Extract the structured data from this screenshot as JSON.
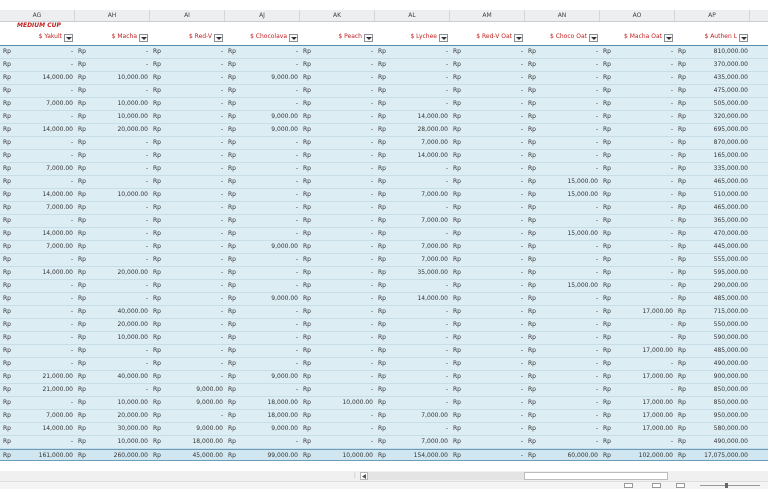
{
  "columns": [
    "AG",
    "AH",
    "AI",
    "AJ",
    "AK",
    "AL",
    "AM",
    "AN",
    "AO",
    "AP"
  ],
  "section_label": "MEDIUM CUP",
  "fields": [
    "$ Yakult",
    "$ Macha",
    "$ Red-V",
    "$ Chocolava",
    "$ Peach",
    "$ Lychee",
    "$ Red-V Oat",
    "$ Choco Oat",
    "$ Macha Oat",
    "$ Authen L"
  ],
  "currency": "Rp",
  "rows": [
    [
      "-",
      "-",
      "-",
      "-",
      "-",
      "-",
      "-",
      "-",
      "-",
      "810,000.00"
    ],
    [
      "-",
      "-",
      "-",
      "-",
      "-",
      "-",
      "-",
      "-",
      "-",
      "370,000.00"
    ],
    [
      "14,000.00",
      "10,000.00",
      "-",
      "9,000.00",
      "-",
      "-",
      "-",
      "-",
      "-",
      "435,000.00"
    ],
    [
      "-",
      "-",
      "-",
      "-",
      "-",
      "-",
      "-",
      "-",
      "-",
      "475,000.00"
    ],
    [
      "7,000.00",
      "10,000.00",
      "-",
      "-",
      "-",
      "-",
      "-",
      "-",
      "-",
      "505,000.00"
    ],
    [
      "-",
      "10,000.00",
      "-",
      "9,000.00",
      "-",
      "14,000.00",
      "-",
      "-",
      "-",
      "320,000.00"
    ],
    [
      "14,000.00",
      "20,000.00",
      "-",
      "9,000.00",
      "-",
      "28,000.00",
      "-",
      "-",
      "-",
      "695,000.00"
    ],
    [
      "-",
      "-",
      "-",
      "-",
      "-",
      "7,000.00",
      "-",
      "-",
      "-",
      "870,000.00"
    ],
    [
      "-",
      "-",
      "-",
      "-",
      "-",
      "14,000.00",
      "-",
      "-",
      "-",
      "165,000.00"
    ],
    [
      "7,000.00",
      "-",
      "-",
      "-",
      "-",
      "-",
      "-",
      "-",
      "-",
      "335,000.00"
    ],
    [
      "-",
      "-",
      "-",
      "-",
      "-",
      "-",
      "-",
      "15,000.00",
      "-",
      "465,000.00"
    ],
    [
      "14,000.00",
      "10,000.00",
      "-",
      "-",
      "-",
      "7,000.00",
      "-",
      "15,000.00",
      "-",
      "510,000.00"
    ],
    [
      "7,000.00",
      "-",
      "-",
      "-",
      "-",
      "-",
      "-",
      "-",
      "-",
      "465,000.00"
    ],
    [
      "-",
      "-",
      "-",
      "-",
      "-",
      "7,000.00",
      "-",
      "-",
      "-",
      "365,000.00"
    ],
    [
      "14,000.00",
      "-",
      "-",
      "-",
      "-",
      "-",
      "-",
      "15,000.00",
      "-",
      "470,000.00"
    ],
    [
      "7,000.00",
      "-",
      "-",
      "9,000.00",
      "-",
      "7,000.00",
      "-",
      "-",
      "-",
      "445,000.00"
    ],
    [
      "-",
      "-",
      "-",
      "-",
      "-",
      "7,000.00",
      "-",
      "-",
      "-",
      "555,000.00"
    ],
    [
      "14,000.00",
      "20,000.00",
      "-",
      "-",
      "-",
      "35,000.00",
      "-",
      "-",
      "-",
      "595,000.00"
    ],
    [
      "-",
      "-",
      "-",
      "-",
      "-",
      "-",
      "-",
      "15,000.00",
      "-",
      "290,000.00"
    ],
    [
      "-",
      "-",
      "-",
      "9,000.00",
      "-",
      "14,000.00",
      "-",
      "-",
      "-",
      "485,000.00"
    ],
    [
      "-",
      "40,000.00",
      "-",
      "-",
      "-",
      "-",
      "-",
      "-",
      "17,000.00",
      "715,000.00"
    ],
    [
      "-",
      "20,000.00",
      "-",
      "-",
      "-",
      "-",
      "-",
      "-",
      "-",
      "550,000.00"
    ],
    [
      "-",
      "10,000.00",
      "-",
      "-",
      "-",
      "-",
      "-",
      "-",
      "-",
      "590,000.00"
    ],
    [
      "-",
      "-",
      "-",
      "-",
      "-",
      "-",
      "-",
      "-",
      "17,000.00",
      "485,000.00"
    ],
    [
      "-",
      "-",
      "-",
      "-",
      "-",
      "-",
      "-",
      "-",
      "-",
      "490,000.00"
    ],
    [
      "21,000.00",
      "40,000.00",
      "-",
      "9,000.00",
      "-",
      "-",
      "-",
      "-",
      "17,000.00",
      "900,000.00"
    ],
    [
      "21,000.00",
      "-",
      "9,000.00",
      "-",
      "-",
      "-",
      "-",
      "-",
      "-",
      "850,000.00"
    ],
    [
      "-",
      "10,000.00",
      "9,000.00",
      "18,000.00",
      "10,000.00",
      "-",
      "-",
      "-",
      "17,000.00",
      "850,000.00"
    ],
    [
      "7,000.00",
      "20,000.00",
      "-",
      "18,000.00",
      "-",
      "7,000.00",
      "-",
      "-",
      "17,000.00",
      "950,000.00"
    ],
    [
      "14,000.00",
      "30,000.00",
      "9,000.00",
      "9,000.00",
      "-",
      "-",
      "-",
      "-",
      "17,000.00",
      "580,000.00"
    ],
    [
      "-",
      "10,000.00",
      "18,000.00",
      "-",
      "-",
      "7,000.00",
      "-",
      "-",
      "-",
      "490,000.00"
    ]
  ],
  "totals": [
    "161,000.00",
    "260,000.00",
    "45,000.00",
    "99,000.00",
    "10,000.00",
    "154,000.00",
    "-",
    "60,000.00",
    "102,000.00",
    "17,075,000.00"
  ]
}
